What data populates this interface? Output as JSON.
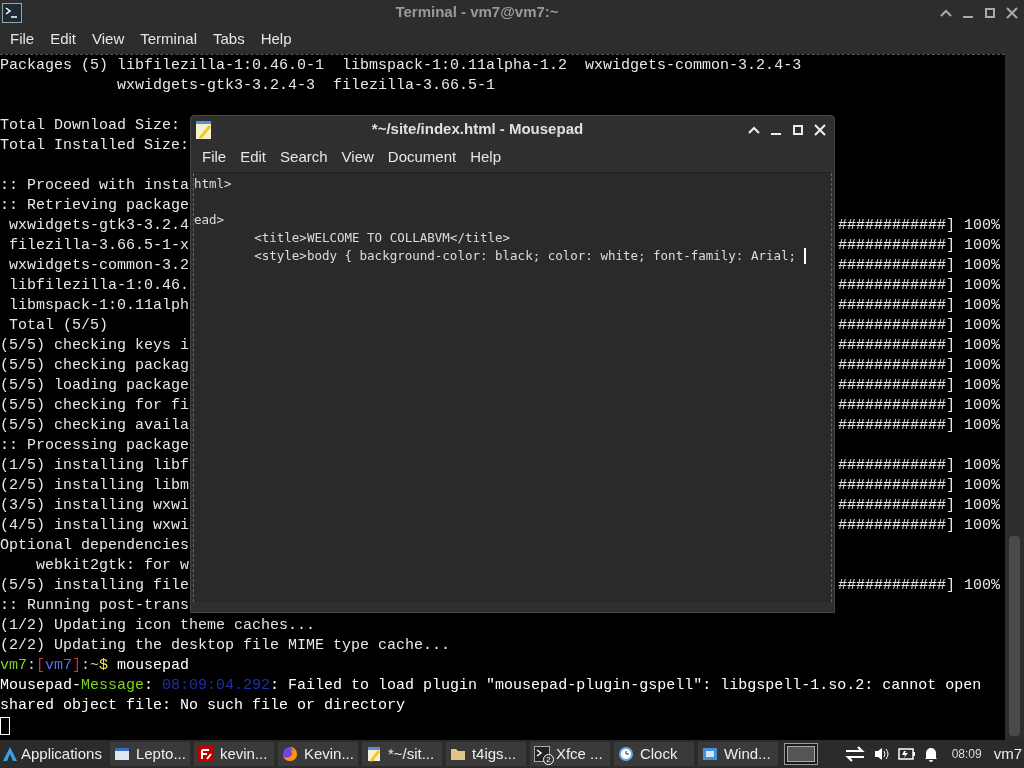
{
  "terminal": {
    "title": "Terminal - vm7@vm7:~",
    "menu": [
      "File",
      "Edit",
      "View",
      "Terminal",
      "Tabs",
      "Help"
    ],
    "lines": [
      {
        "kind": "text",
        "text": "Packages (5) libfilezilla-1:0.46.0-1  libmspack-1:0.11alpha-1.2  wxwidgets-common-3.2.4-3"
      },
      {
        "kind": "text",
        "text": "             wxwidgets-gtk3-3.2.4-3  filezilla-3.66.5-1"
      },
      {
        "kind": "blank"
      },
      {
        "kind": "text",
        "text": "Total Download Size:"
      },
      {
        "kind": "text",
        "text": "Total Installed Size:"
      },
      {
        "kind": "blank"
      },
      {
        "kind": "text",
        "text": ":: Proceed with insta"
      },
      {
        "kind": "text",
        "text": ":: Retrieving package"
      },
      {
        "kind": "text",
        "text": " wxwidgets-gtk3-3.2.4",
        "right": "############] 100%"
      },
      {
        "kind": "text",
        "text": " filezilla-3.66.5-1-x",
        "right": "############] 100%"
      },
      {
        "kind": "text",
        "text": " wxwidgets-common-3.2",
        "right": "############] 100%"
      },
      {
        "kind": "text",
        "text": " libfilezilla-1:0.46.",
        "right": "############] 100%"
      },
      {
        "kind": "text",
        "text": " libmspack-1:0.11alph",
        "right": "############] 100%"
      },
      {
        "kind": "text",
        "text": " Total (5/5)",
        "right": "############] 100%"
      },
      {
        "kind": "text",
        "text": "(5/5) checking keys i",
        "right": "############] 100%"
      },
      {
        "kind": "text",
        "text": "(5/5) checking packag",
        "right": "############] 100%"
      },
      {
        "kind": "text",
        "text": "(5/5) loading package",
        "right": "############] 100%"
      },
      {
        "kind": "text",
        "text": "(5/5) checking for fi",
        "right": "############] 100%"
      },
      {
        "kind": "text",
        "text": "(5/5) checking availa",
        "right": "############] 100%"
      },
      {
        "kind": "text",
        "text": ":: Processing package"
      },
      {
        "kind": "text",
        "text": "(1/5) installing libf",
        "right": "############] 100%"
      },
      {
        "kind": "text",
        "text": "(2/5) installing libm",
        "right": "############] 100%"
      },
      {
        "kind": "text",
        "text": "(3/5) installing wxwi",
        "right": "############] 100%"
      },
      {
        "kind": "text",
        "text": "(4/5) installing wxwi",
        "right": "############] 100%"
      },
      {
        "kind": "text",
        "text": "Optional dependencies"
      },
      {
        "kind": "text",
        "text": "    webkit2gtk: for w"
      },
      {
        "kind": "text",
        "text": "(5/5) installing file",
        "right": "############] 100%"
      },
      {
        "kind": "text",
        "text": ":: Running post-trans"
      },
      {
        "kind": "text",
        "text": "(1/2) Updating icon theme caches..."
      },
      {
        "kind": "text",
        "text": "(2/2) Updating the desktop file MIME type cache..."
      },
      {
        "kind": "parts",
        "parts": [
          {
            "text": "vm7",
            "color": "#7ed321"
          },
          {
            "text": ":",
            "color": "#d0d0d0"
          },
          {
            "text": "[",
            "color": "#d0342c"
          },
          {
            "text": "vm7",
            "color": "#5b6cf0"
          },
          {
            "text": "]",
            "color": "#d0342c"
          },
          {
            "text": ":~",
            "color": "#d0d0d0"
          },
          {
            "text": "$",
            "color": "#f5e642"
          },
          {
            "text": " mousepad",
            "color": "#ffffff"
          }
        ]
      },
      {
        "kind": "parts",
        "parts": [
          {
            "text": "Mousepad-",
            "color": "#ffffff"
          },
          {
            "text": "Message",
            "color": "#7ed321"
          },
          {
            "text": ": ",
            "color": "#ffffff"
          },
          {
            "text": "08:09:04.292",
            "color": "#1f2fa8"
          },
          {
            "text": ": Failed to load plugin \"mousepad-plugin-gspell\": libgspell-1.so.2: cannot open shared object file: No such file or directory",
            "color": "#ffffff"
          }
        ]
      },
      {
        "kind": "cursor"
      }
    ]
  },
  "mousepad": {
    "title": "*~/site/index.html - Mousepad",
    "menu": [
      "File",
      "Edit",
      "Search",
      "View",
      "Document",
      "Help"
    ],
    "lines": [
      {
        "kind": "text",
        "text": "html>"
      },
      {
        "kind": "blank"
      },
      {
        "kind": "text",
        "text": "ead>"
      },
      {
        "kind": "text",
        "text": "        <title>WELCOME TO COLLABVM</title>"
      },
      {
        "kind": "text",
        "text": "        <style>body { background-color: black; color: white; font-family: Arial; ",
        "cursor": true
      }
    ]
  },
  "taskbar": {
    "start": "Applications",
    "tasks": [
      {
        "label": "Lepto...",
        "kind": "window"
      },
      {
        "label": "kevin...",
        "kind": "filezilla"
      },
      {
        "label": "Kevin...",
        "kind": "browser"
      },
      {
        "label": "*~/sit...",
        "kind": "notepad"
      },
      {
        "label": "t4igs...",
        "kind": "folder"
      },
      {
        "label": "Xfce ...",
        "kind": "terminal",
        "badge": "2"
      },
      {
        "label": "Clock",
        "kind": "clock"
      },
      {
        "label": "Wind...",
        "kind": "window2"
      }
    ],
    "clock": "08:09",
    "user": "vm7"
  }
}
